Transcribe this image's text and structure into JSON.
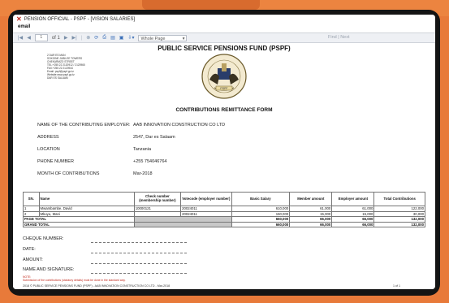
{
  "window": {
    "title": "PENSION OFFICIAL - PSPF - [VISION SALARIES]"
  },
  "menu": {
    "item": "email"
  },
  "toolbar": {
    "page_current": "1",
    "page_of": "of 1",
    "zoom": "Whole Page",
    "find_label": "Find",
    "next_label": "Next"
  },
  "report": {
    "org_title": "PUBLIC SERVICE PENSIONS FUND (PSPF)",
    "address_lines": [
      "2 DAR ES MAN",
      "SOKOINE JUBILEE TOWERS",
      "CHEKARMZO STREET",
      "TEL:+255 22 2120912 / 2120965",
      "FAX:+255 22 2120944",
      "Email: pspf@pspf.go.tz",
      "Website:www.pspf.go.tz",
      "DAR ES SALAAM"
    ],
    "seal_text": "PSPF",
    "form_title": "CONTRIBUTIONS REMITTANCE FORM",
    "fields": [
      {
        "label": "NAME OF THE CONTRIBUTING EMPLOYER:",
        "value": "AAB INNOVATION CONSTRUCTION CO LTD"
      },
      {
        "label": "ADDRESS",
        "value": "2547, Dar es Salaam"
      },
      {
        "label": "LOCATION",
        "value": "Tanzania"
      },
      {
        "label": "PHONE NUMBER",
        "value": "+255 754046764"
      },
      {
        "label": "MONTH OF CONTRIBUTIONS",
        "value": "Mar-2018"
      }
    ],
    "table": {
      "headers": [
        "SN.",
        "Name",
        "Check number (membership number)",
        "Votecode (employer number)",
        "Basic Salary",
        "Member amount",
        "Employer amount",
        "Total Contributions"
      ],
      "rows": [
        [
          "1",
          "Mwambambe, David",
          "10000121",
          "20024011",
          "610,000",
          "61,000",
          "61,000",
          "122,000"
        ],
        [
          "2",
          "Mkuyu, Mani",
          "",
          "20024011",
          "150,000",
          "15,000",
          "15,000",
          "30,000"
        ]
      ],
      "page_total_label": "PAGE TOTAL",
      "page_total": [
        "660,000",
        "66,000",
        "66,000",
        "132,000"
      ],
      "grand_total_label": "GRAND TOTAL",
      "grand_total": [
        "660,000",
        "66,000",
        "66,000",
        "132,000"
      ]
    },
    "signature_fields": [
      "CHEQUE NUMBER:",
      "DATE:",
      "AMOUNT:",
      "NAME AND SIGNATURE:"
    ],
    "note_title": "NOTE:",
    "note_text": "Submission of the contributions (statutory details) must be done in the standard way.",
    "footer_text": "2018 © PUBLIC SERVICE PENSIONS FUND (PSPF) - AAB INNOVATION CONSTRUCTION CO LTD - Mar-2018",
    "page_indicator": "1 of 1"
  }
}
